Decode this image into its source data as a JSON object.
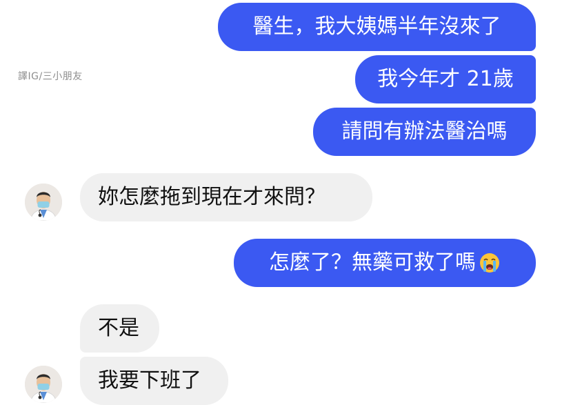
{
  "watermark": "譯IG/三小朋友",
  "messages": [
    {
      "id": "m1",
      "sender": "me",
      "text": "醫生，我大姨媽半年沒來了"
    },
    {
      "id": "m2",
      "sender": "me",
      "text": "我今年才 21歲"
    },
    {
      "id": "m3",
      "sender": "me",
      "text": "請問有辦法醫治嗎"
    },
    {
      "id": "m4",
      "sender": "doctor",
      "text": "妳怎麼拖到現在才來問？"
    },
    {
      "id": "m5",
      "sender": "me",
      "text": "怎麼了？無藥可救了嗎",
      "emoji": "loudly-crying-face-icon"
    },
    {
      "id": "m6",
      "sender": "doctor",
      "text": "不是"
    },
    {
      "id": "m7",
      "sender": "doctor",
      "text": "我要下班了"
    }
  ],
  "colors": {
    "outgoing_bubble": "#3b59f2",
    "outgoing_text": "#ffffff",
    "incoming_bubble": "#f0f0f0",
    "incoming_text": "#111111",
    "watermark": "#8e8e8e"
  },
  "icons": {
    "doctor_avatar": "doctor-avatar-icon"
  }
}
